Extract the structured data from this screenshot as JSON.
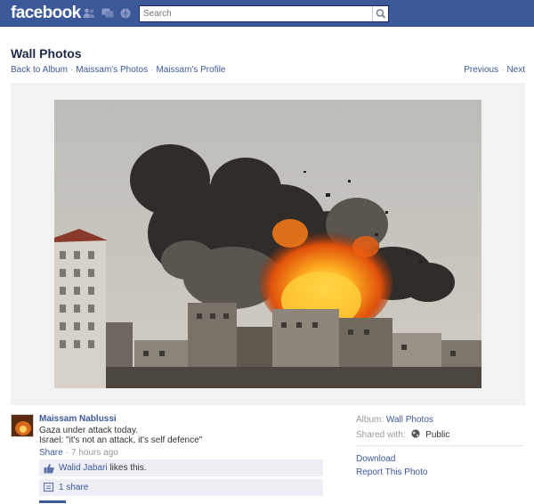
{
  "topbar": {
    "logo": "facebook",
    "search_placeholder": "Search",
    "brand_color": "#3b5998",
    "icons": [
      "friend-requests-icon",
      "messages-icon",
      "notifications-icon",
      "search-icon"
    ]
  },
  "header": {
    "title": "Wall Photos",
    "breadcrumb": [
      "Back to Album",
      "Maissam's Photos",
      "Maissam's Profile"
    ],
    "pager": {
      "previous": "Previous",
      "next": "Next"
    }
  },
  "photo": {
    "description_icon": "explosion-photo"
  },
  "post": {
    "author": "Maissam Nablussi",
    "caption_lines": [
      "Gaza under attack today.",
      "Israel: \"it's not an attack, it's self defence\""
    ],
    "share_label": "Share",
    "timestamp": "7 hours ago",
    "likes": {
      "name": "Walid Jabari",
      "text": "likes this."
    },
    "shares": "1 share"
  },
  "sidebar": {
    "album_label": "Album:",
    "album_value": "Wall Photos",
    "shared_label": "Shared with:",
    "shared_value": "Public",
    "download": "Download",
    "report": "Report This Photo"
  }
}
